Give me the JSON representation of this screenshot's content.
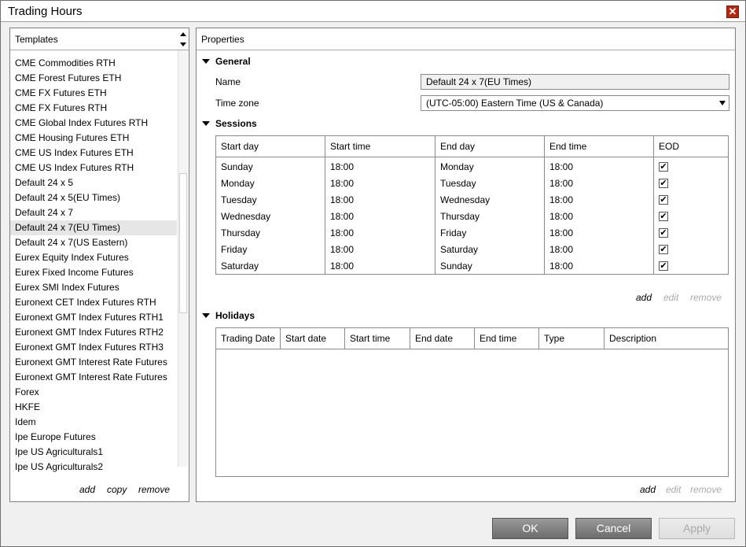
{
  "window": {
    "title": "Trading Hours",
    "close_glyph": "✕"
  },
  "templates": {
    "header": "Templates",
    "items": [
      "CME Commodities RTH",
      "CME Forest Futures ETH",
      "CME FX Futures ETH",
      "CME FX Futures RTH",
      "CME Global Index Futures RTH",
      "CME Housing Futures ETH",
      "CME US Index Futures ETH",
      "CME US Index Futures RTH",
      "Default 24 x 5",
      "Default 24 x 5(EU Times)",
      "Default 24 x 7",
      "Default 24 x 7(EU Times)",
      "Default 24 x 7(US Eastern)",
      "Eurex Equity Index Futures",
      "Eurex Fixed Income Futures",
      "Eurex SMI Index Futures",
      "Euronext CET Index Futures RTH",
      "Euronext GMT Index Futures RTH1",
      "Euronext GMT Index Futures RTH2",
      "Euronext GMT Index Futures RTH3",
      "Euronext GMT Interest Rate Futures",
      "Euronext GMT Interest Rate Futures",
      "Forex",
      "HKFE",
      "Idem",
      "Ipe Europe Futures",
      "Ipe US Agriculturals1",
      "Ipe US Agriculturals2"
    ],
    "selected_index": 11,
    "add": "add",
    "copy": "copy",
    "remove": "remove"
  },
  "properties": {
    "header": "Properties",
    "general": {
      "title": "General",
      "name_label": "Name",
      "name_value": "Default 24 x 7(EU Times)",
      "tz_label": "Time zone",
      "tz_value": "(UTC-05:00) Eastern Time (US & Canada)"
    },
    "sessions": {
      "title": "Sessions",
      "columns": [
        "Start day",
        "Start time",
        "End day",
        "End time",
        "EOD"
      ],
      "rows": [
        [
          "Sunday",
          "18:00",
          "Monday",
          "18:00",
          true
        ],
        [
          "Monday",
          "18:00",
          "Tuesday",
          "18:00",
          true
        ],
        [
          "Tuesday",
          "18:00",
          "Wednesday",
          "18:00",
          true
        ],
        [
          "Wednesday",
          "18:00",
          "Thursday",
          "18:00",
          true
        ],
        [
          "Thursday",
          "18:00",
          "Friday",
          "18:00",
          true
        ],
        [
          "Friday",
          "18:00",
          "Saturday",
          "18:00",
          true
        ],
        [
          "Saturday",
          "18:00",
          "Sunday",
          "18:00",
          true
        ]
      ],
      "check_glyph": "✔",
      "add": "add",
      "edit": "edit",
      "remove": "remove"
    },
    "holidays": {
      "title": "Holidays",
      "columns": [
        "Trading Date",
        "Start date",
        "Start time",
        "End date",
        "End time",
        "Type",
        "Description"
      ],
      "add": "add",
      "edit": "edit",
      "remove": "remove"
    }
  },
  "buttons": {
    "ok": "OK",
    "cancel": "Cancel",
    "apply": "Apply"
  }
}
